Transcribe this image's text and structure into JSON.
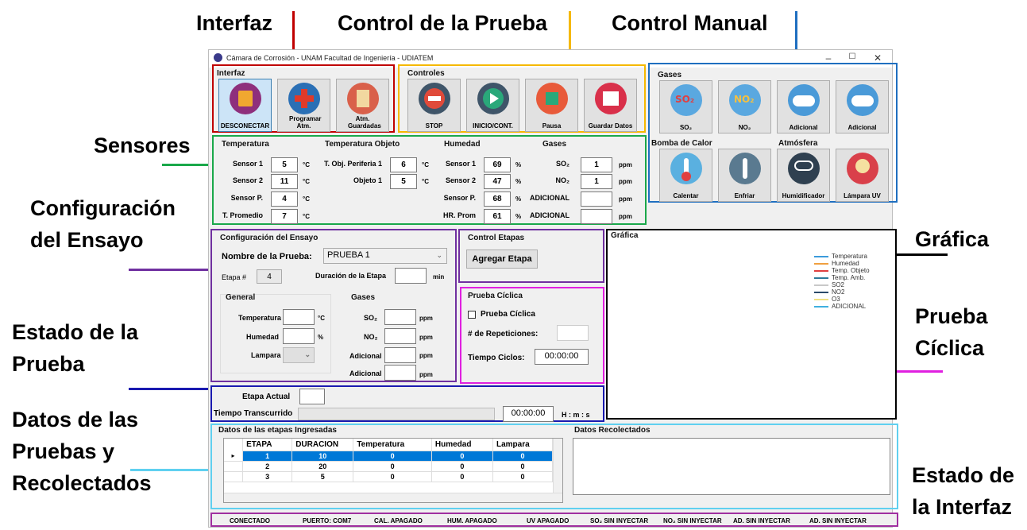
{
  "annotations": {
    "interfaz": "Interfaz",
    "control_prueba": "Control de la Prueba",
    "control_manual": "Control Manual",
    "sensores": "Sensores",
    "configuracion_1": "Configuración",
    "configuracion_2": "del Ensayo",
    "grafica": "Gráfica",
    "estado_prueba_1": "Estado de la",
    "estado_prueba_2": "Prueba",
    "prueba_ciclica_1": "Prueba",
    "prueba_ciclica_2": "Cíclica",
    "datos_1": "Datos de las",
    "datos_2": "Pruebas y",
    "datos_3": "Recolectados",
    "estado_interfaz_1": "Estado de",
    "estado_interfaz_2": "la Interfaz"
  },
  "window": {
    "title": "Cámara de Corrosión - UNAM Facultad de Ingeniería - UDIATEM",
    "min": "–",
    "max": "☐",
    "close": "✕"
  },
  "interfaz_group": {
    "title": "Interfaz",
    "buttons": [
      "DESCONECTAR",
      "Programar Atm.",
      "Atm. Guardadas"
    ]
  },
  "controles_group": {
    "title": "Controles",
    "buttons": [
      "STOP",
      "INICIO/CONT.",
      "Pausa",
      "Guardar Datos"
    ]
  },
  "gases_group": {
    "title": "Gases",
    "buttons": [
      "SO₂",
      "NO₂",
      "Adicional",
      "Adicional"
    ],
    "icon_text": [
      "SO₂",
      "NO₂"
    ]
  },
  "bomba_group": {
    "title": "Bomba de Calor",
    "buttons": [
      "Calentar",
      "Enfriar"
    ]
  },
  "atmosfera_group": {
    "title": "Atmósfera",
    "buttons": [
      "Humidificador",
      "Lámpara UV"
    ]
  },
  "sensores": {
    "temperatura": {
      "title": "Temperatura",
      "rows": [
        {
          "label": "Sensor 1",
          "value": "5",
          "unit": "°C"
        },
        {
          "label": "Sensor 2",
          "value": "11",
          "unit": "°C"
        },
        {
          "label": "Sensor P.",
          "value": "4",
          "unit": "°C"
        },
        {
          "label": "T. Promedio",
          "value": "7",
          "unit": "°C"
        }
      ]
    },
    "temp_objeto": {
      "title": "Temperatura Objeto",
      "rows": [
        {
          "label": "T. Obj. Periferia 1",
          "value": "6",
          "unit": "°C"
        },
        {
          "label": "Objeto 1",
          "value": "5",
          "unit": "°C"
        }
      ]
    },
    "humedad": {
      "title": "Humedad",
      "rows": [
        {
          "label": "Sensor 1",
          "value": "69",
          "unit": "%"
        },
        {
          "label": "Sensor 2",
          "value": "47",
          "unit": "%"
        },
        {
          "label": "Sensor P.",
          "value": "68",
          "unit": "%"
        },
        {
          "label": "HR. Prom",
          "value": "61",
          "unit": "%"
        }
      ]
    },
    "gases": {
      "title": "Gases",
      "rows": [
        {
          "label": "SO₂",
          "value": "1",
          "unit": "ppm"
        },
        {
          "label": "NO₂",
          "value": "1",
          "unit": "ppm"
        },
        {
          "label": "ADICIONAL",
          "value": "",
          "unit": "ppm"
        },
        {
          "label": "ADICIONAL",
          "value": "",
          "unit": "ppm"
        }
      ]
    }
  },
  "config": {
    "title": "Configuración del Ensayo",
    "nombre_label": "Nombre de la Prueba:",
    "nombre_value": "PRUEBA 1",
    "etapa_label": "Etapa #",
    "etapa_value": "4",
    "duracion_label": "Duración de la Etapa",
    "duracion_unit": "min",
    "general_title": "General",
    "temperatura_label": "Temperatura",
    "temperatura_unit": "°C",
    "humedad_label": "Humedad",
    "humedad_unit": "%",
    "lampara_label": "Lampara",
    "gases_title": "Gases",
    "so2_label": "SO₂",
    "no2_label": "NO₂",
    "adicional_label": "Adicional",
    "ppm": "ppm"
  },
  "control_etapas": {
    "title": "Control Etapas",
    "button": "Agregar Etapa"
  },
  "ciclica": {
    "title": "Prueba Cíclica",
    "checkbox_label": "Prueba Cíclica",
    "repeticiones_label": "# de Repeticiones:",
    "tiempo_label": "Tiempo Ciclos:",
    "tiempo_value": "00:00:00"
  },
  "grafica": {
    "title": "Gráfica",
    "legend": [
      {
        "name": "Temperatura",
        "color": "#3c9bdc"
      },
      {
        "name": "Humedad",
        "color": "#f0a040"
      },
      {
        "name": "Temp. Objeto",
        "color": "#e04040"
      },
      {
        "name": "Temp. Amb.",
        "color": "#2d7a9a"
      },
      {
        "name": "SO2",
        "color": "#c8c8c8"
      },
      {
        "name": "NO2",
        "color": "#2a4a6a"
      },
      {
        "name": "O3",
        "color": "#f0e080"
      },
      {
        "name": "ADICIONAL",
        "color": "#40b0e0"
      }
    ]
  },
  "estado": {
    "etapa_actual_label": "Etapa Actual",
    "tiempo_label": "Tiempo Transcurrido",
    "tiempo_value": "00:00:00",
    "format": "H : m : s"
  },
  "datos": {
    "title": "Datos de las etapas Ingresadas",
    "recolectados_title": "Datos Recolectados",
    "columns": [
      "ETAPA",
      "DURACION",
      "Temperatura",
      "Humedad",
      "Lampara"
    ],
    "rows": [
      [
        "1",
        "10",
        "0",
        "0",
        "0"
      ],
      [
        "2",
        "20",
        "0",
        "0",
        "0"
      ],
      [
        "3",
        "5",
        "0",
        "0",
        "0"
      ]
    ]
  },
  "status_bar": [
    "CONECTADO",
    "PUERTO: COM7",
    "CAL. APAGADO",
    "HUM. APAGADO",
    "UV APAGADO",
    "SO₂ SIN INYECTAR",
    "NO₂ SIN INYECTAR",
    "AD. SIN INYECTAR",
    "AD. SIN INYECTAR"
  ],
  "colors": {
    "interfaz": "#c00000",
    "control_prueba": "#f5b800",
    "control_manual": "#1f6fc0",
    "sensores": "#1aa84a",
    "configuracion": "#7030a0",
    "estado": "#1a1ab0",
    "grafica": "#000000",
    "ciclica": "#e020e0",
    "datos": "#60d0f0",
    "status": "#a030a0"
  }
}
